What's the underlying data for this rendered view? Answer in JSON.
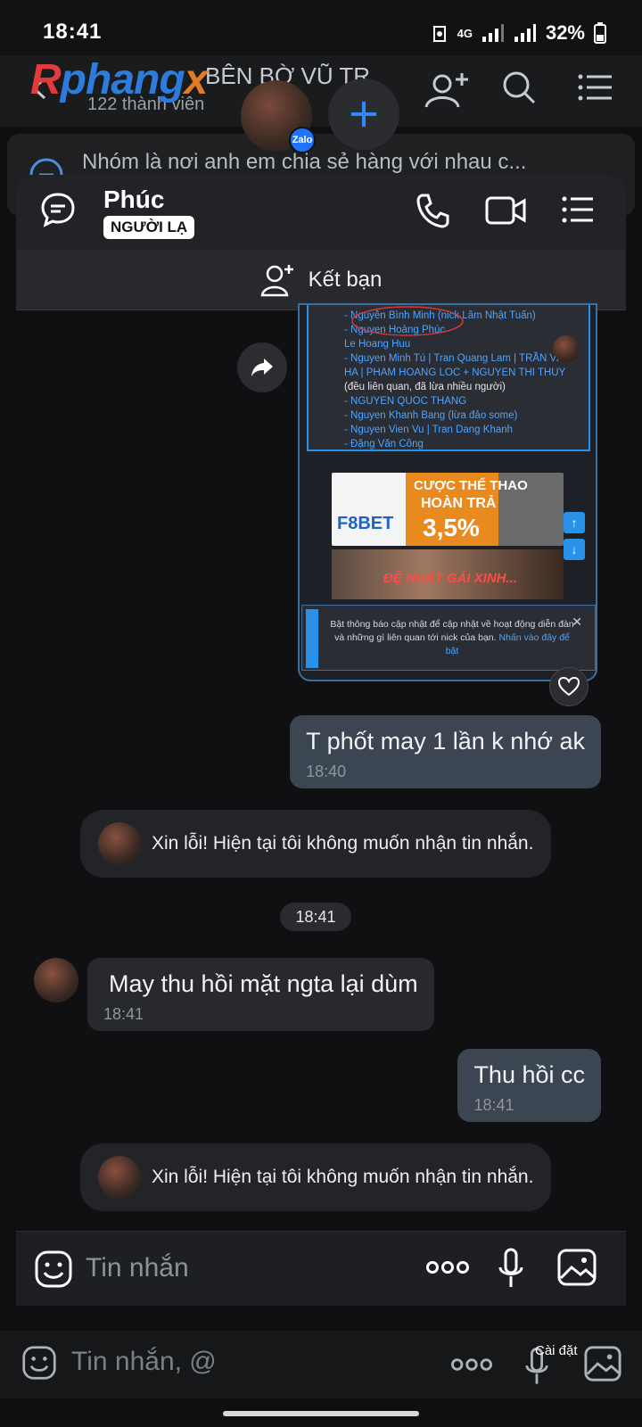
{
  "status_bar": {
    "time": "18:41",
    "network": "4G",
    "battery": "32%"
  },
  "group": {
    "name": "BÊN BỜ VŨ TR",
    "members": "122 thành viên",
    "description": "Nhóm là nơi anh em chia sẻ hàng với nhau c...",
    "logo_parts": [
      "R",
      "phang",
      "x"
    ]
  },
  "zalo_badge": "Zalo",
  "chat": {
    "contact_name": "Phúc",
    "badge": "NGƯỜI LẠ",
    "add_friend_label": "Kết bạn"
  },
  "shared_screenshot": {
    "list_lines": [
      "- Nguyễn Bình Minh (nick Lâm Nhật Tuấn)",
      "- Nguyen Hoàng Phúc",
      "Le Hoang Huu",
      "- Nguyen Minh Tú | Tran Quang Lam | TRẦN VĂN",
      "HA | PHAM HOANG LOC + NGUYEN THI THUY",
      "(đều liên quan, đã lừa nhiều người)",
      "- NGUYEN QUOC THANG",
      "- Nguyen Khanh Bang (lừa đảo some)",
      "- Nguyen Vien Vu | Tran Dang Khanh",
      "- Đặng Văn Công"
    ],
    "ad1": {
      "brand": "F8BET",
      "line1": "CƯỢC THỂ THAO",
      "line2": "HOÀN TRẢ",
      "line3": "3,5%"
    },
    "ad2": {
      "text": "ĐỆ NHẤT GÁI XINH..."
    },
    "notice_text": "Bật thông báo cập nhật để cập nhật về hoạt động diễn đàn và những gì liên quan tới nick của bạn.",
    "notice_link": "Nhấn vào đây để bật"
  },
  "messages": [
    {
      "dir": "out",
      "text": "T phốt may 1 lần k nhớ ak",
      "time": "18:40"
    },
    {
      "dir": "system",
      "text": "Xin lỗi! Hiện tại tôi không muốn nhận tin nhắn."
    },
    {
      "dir": "divider",
      "text": "18:41"
    },
    {
      "dir": "in",
      "text": "May thu hồi mặt ngta lại dùm",
      "time": "18:41"
    },
    {
      "dir": "out",
      "text": "Thu hồi cc",
      "time": "18:41"
    },
    {
      "dir": "system",
      "text": "Xin lỗi! Hiện tại tôi không muốn nhận tin nhắn."
    }
  ],
  "composer": {
    "placeholder": "Tin nhắn"
  },
  "bg_composer": {
    "placeholder": "Tin nhắn, @",
    "settings_label": "Cài đặt"
  }
}
